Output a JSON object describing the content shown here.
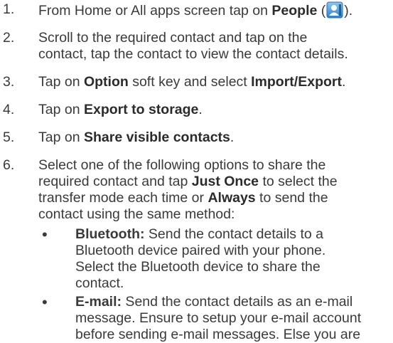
{
  "steps": [
    {
      "num": "1.",
      "pre": "From Home or All apps screen tap on ",
      "b1": "People",
      "mid": " (",
      "post": ")."
    },
    {
      "num": "2.",
      "line1": "Scroll to the required contact and tap on the",
      "line2": "contact, tap the contact to view the contact details."
    },
    {
      "num": "3.",
      "pre": "Tap on ",
      "b1": "Option",
      "mid": " soft key and select ",
      "b2": "Import/Export",
      "post": "."
    },
    {
      "num": "4.",
      "pre": "Tap on ",
      "b1": "Export to storage",
      "post": "."
    },
    {
      "num": "5.",
      "pre": "Tap on ",
      "b1": "Share visible contacts",
      "post": "."
    },
    {
      "num": "6.",
      "l1": "Select one of the following options to share the",
      "l2pre": "required contact and tap ",
      "l2b": "Just Once",
      "l2post": " to select the",
      "l3pre": "transfer mode each time or ",
      "l3b": "Always",
      "l3post": " to send the",
      "l4": "contact using the same method:"
    }
  ],
  "bullets": [
    {
      "glyph": "•",
      "bold": "Bluetooth:",
      "l1": " Send the contact details to a",
      "l2": "Bluetooth device paired with your phone.",
      "l3": "Select the Bluetooth device to share the",
      "l4": "contact."
    },
    {
      "glyph": "•",
      "bold": "E-mail:",
      "l1": " Send the contact details as an e-mail",
      "l2": "message. Ensure to setup your e-mail account",
      "l3": "before sending e-mail messages. Else you are"
    }
  ],
  "icons": {
    "people": "people-app-icon"
  },
  "colors": {
    "text": "#3a3a3a",
    "icon_blue": "#3d8fd6"
  }
}
